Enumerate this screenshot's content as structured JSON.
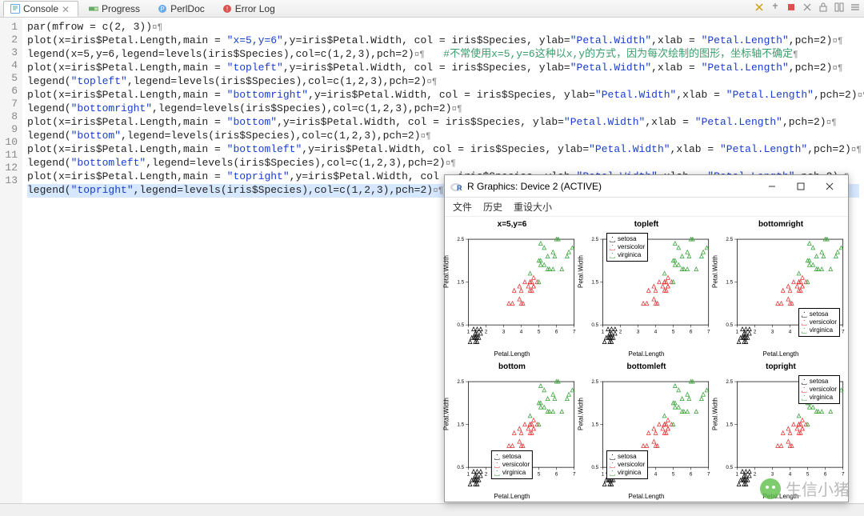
{
  "tabs": [
    {
      "label": "Console",
      "icon": "console-icon",
      "active": true
    },
    {
      "label": "Progress",
      "icon": "progress-icon"
    },
    {
      "label": "PerlDoc",
      "icon": "perldoc-icon"
    },
    {
      "label": "Error Log",
      "icon": "errorlog-icon"
    }
  ],
  "code_lines": [
    {
      "n": 1,
      "t": "par(mfrow = c(2, 3))"
    },
    {
      "n": 2,
      "t": "plot(x=iris$Petal.Length,main = \"x=5,y=6\",y=iris$Petal.Width, col = iris$Species, ylab=\"Petal.Width\",xlab = \"Petal.Length\",pch=2)"
    },
    {
      "n": 3,
      "t": "legend(x=5,y=6,legend=levels(iris$Species),col=c(1,2,3),pch=2)",
      "comment": "#不常使用x=5,y=6这种以x,y的方式，因为每次绘制的图形，坐标轴不确定"
    },
    {
      "n": 4,
      "t": "plot(x=iris$Petal.Length,main = \"topleft\",y=iris$Petal.Width, col = iris$Species, ylab=\"Petal.Width\",xlab = \"Petal.Length\",pch=2)"
    },
    {
      "n": 5,
      "t": "legend(\"topleft\",legend=levels(iris$Species),col=c(1,2,3),pch=2)"
    },
    {
      "n": 6,
      "t": "plot(x=iris$Petal.Length,main = \"bottomright\",y=iris$Petal.Width, col = iris$Species, ylab=\"Petal.Width\",xlab = \"Petal.Length\",pch=2)"
    },
    {
      "n": 7,
      "t": "legend(\"bottomright\",legend=levels(iris$Species),col=c(1,2,3),pch=2)"
    },
    {
      "n": 8,
      "t": "plot(x=iris$Petal.Length,main = \"bottom\",y=iris$Petal.Width, col = iris$Species, ylab=\"Petal.Width\",xlab = \"Petal.Length\",pch=2)"
    },
    {
      "n": 9,
      "t": "legend(\"bottom\",legend=levels(iris$Species),col=c(1,2,3),pch=2)"
    },
    {
      "n": 10,
      "t": "plot(x=iris$Petal.Length,main = \"bottomleft\",y=iris$Petal.Width, col = iris$Species, ylab=\"Petal.Width\",xlab = \"Petal.Length\",pch=2)"
    },
    {
      "n": 11,
      "t": "legend(\"bottomleft\",legend=levels(iris$Species),col=c(1,2,3),pch=2)"
    },
    {
      "n": 12,
      "t": "plot(x=iris$Petal.Length,main = \"topright\",y=iris$Petal.Width, col = iris$Species, ylab=\"Petal.Width\",xlab = \"Petal.Length\",pch=2)"
    },
    {
      "n": 13,
      "t": "legend(\"topright\",legend=levels(iris$Species),col=c(1,2,3),pch=2)",
      "hl": true
    }
  ],
  "rwin": {
    "title": "R Graphics: Device 2 (ACTIVE)",
    "menu": [
      "文件",
      "历史",
      "重设大小"
    ]
  },
  "legend_items": [
    {
      "name": "setosa",
      "color": "#000000"
    },
    {
      "name": "versicolor",
      "color": "#e03030"
    },
    {
      "name": "virginica",
      "color": "#30a030"
    }
  ],
  "watermark": "生信小猪",
  "chart_data": [
    {
      "type": "scatter",
      "title": "x=5,y=6",
      "xlabel": "Petal.Length",
      "ylabel": "Petal.Width",
      "xlim": [
        1,
        7
      ],
      "ylim": [
        0.5,
        2.5
      ],
      "x_ticks": [
        1,
        2,
        3,
        4,
        5,
        6,
        7
      ],
      "y_ticks": [
        0.5,
        1.5,
        2.5
      ],
      "legend_pos": null,
      "series": [
        {
          "name": "setosa",
          "color": "#000000",
          "x": [
            1.4,
            1.4,
            1.3,
            1.5,
            1.4,
            1.7,
            1.4,
            1.5,
            1.4,
            1.5,
            1.5,
            1.6,
            1.4,
            1.1,
            1.2,
            1.5,
            1.3,
            1.4,
            1.7,
            1.5
          ],
          "y": [
            0.2,
            0.2,
            0.2,
            0.2,
            0.2,
            0.4,
            0.3,
            0.2,
            0.2,
            0.1,
            0.2,
            0.2,
            0.1,
            0.1,
            0.2,
            0.4,
            0.4,
            0.3,
            0.3,
            0.3
          ]
        },
        {
          "name": "versicolor",
          "color": "#e03030",
          "x": [
            4.7,
            4.5,
            4.9,
            4.0,
            4.6,
            4.5,
            4.7,
            3.3,
            4.6,
            3.9,
            3.5,
            4.2,
            4.0,
            4.7,
            3.6,
            4.4,
            4.5,
            4.1,
            4.5,
            3.9
          ],
          "y": [
            1.4,
            1.5,
            1.5,
            1.3,
            1.5,
            1.3,
            1.6,
            1.0,
            1.3,
            1.4,
            1.0,
            1.5,
            1.0,
            1.4,
            1.3,
            1.4,
            1.5,
            1.0,
            1.5,
            1.1
          ]
        },
        {
          "name": "virginica",
          "color": "#30a030",
          "x": [
            6.0,
            5.1,
            5.9,
            5.6,
            5.8,
            6.6,
            4.5,
            6.3,
            5.8,
            6.1,
            5.1,
            5.3,
            5.5,
            5.0,
            5.1,
            5.3,
            5.5,
            6.7,
            6.9,
            5.0
          ],
          "y": [
            2.5,
            1.9,
            2.1,
            1.8,
            2.2,
            2.1,
            1.7,
            1.8,
            1.8,
            2.5,
            2.0,
            1.9,
            2.1,
            2.0,
            2.4,
            2.3,
            1.8,
            2.2,
            2.3,
            1.5
          ]
        }
      ]
    },
    {
      "type": "scatter",
      "title": "topleft",
      "xlabel": "Petal.Length",
      "ylabel": "Petal.Width",
      "xlim": [
        1,
        7
      ],
      "ylim": [
        0.5,
        2.5
      ],
      "x_ticks": [
        1,
        2,
        3,
        4,
        5,
        6,
        7
      ],
      "y_ticks": [
        0.5,
        1.5,
        2.5
      ],
      "legend_pos": "topleft",
      "series": "same"
    },
    {
      "type": "scatter",
      "title": "bottomright",
      "xlabel": "Petal.Length",
      "ylabel": "Petal.Width",
      "xlim": [
        1,
        7
      ],
      "ylim": [
        0.5,
        2.5
      ],
      "x_ticks": [
        1,
        2,
        3,
        4,
        5,
        6,
        7
      ],
      "y_ticks": [
        0.5,
        1.5,
        2.5
      ],
      "legend_pos": "bottomright",
      "series": "same"
    },
    {
      "type": "scatter",
      "title": "bottom",
      "xlabel": "Petal.Length",
      "ylabel": "Petal.Width",
      "xlim": [
        1,
        7
      ],
      "ylim": [
        0.5,
        2.5
      ],
      "x_ticks": [
        1,
        2,
        3,
        4,
        5,
        6,
        7
      ],
      "y_ticks": [
        0.5,
        1.5,
        2.5
      ],
      "legend_pos": "bottom",
      "series": "same"
    },
    {
      "type": "scatter",
      "title": "bottomleft",
      "xlabel": "Petal.Length",
      "ylabel": "Petal.Width",
      "xlim": [
        1,
        7
      ],
      "ylim": [
        0.5,
        2.5
      ],
      "x_ticks": [
        1,
        2,
        3,
        4,
        5,
        6,
        7
      ],
      "y_ticks": [
        0.5,
        1.5,
        2.5
      ],
      "legend_pos": "bottomleft",
      "series": "same"
    },
    {
      "type": "scatter",
      "title": "topright",
      "xlabel": "Petal.Length",
      "ylabel": "Petal.Width",
      "xlim": [
        1,
        7
      ],
      "ylim": [
        0.5,
        2.5
      ],
      "x_ticks": [
        1,
        2,
        3,
        4,
        5,
        6,
        7
      ],
      "y_ticks": [
        0.5,
        1.5,
        2.5
      ],
      "legend_pos": "topright",
      "series": "same"
    }
  ]
}
